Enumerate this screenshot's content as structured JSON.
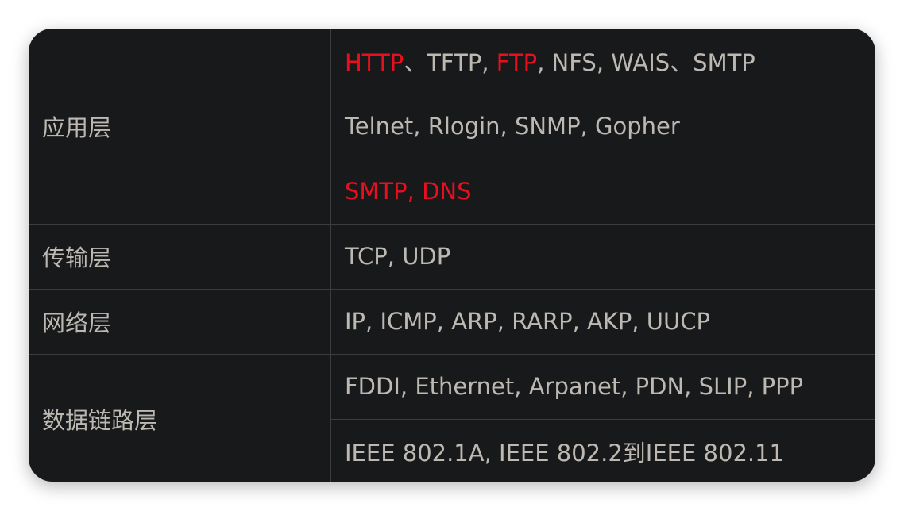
{
  "colors": {
    "card_background": "#18191b",
    "text": "#bdb9b2",
    "highlight": "#ea0f1f",
    "border": "#3a3c3f"
  },
  "table": {
    "layers": [
      {
        "name": "应用层",
        "rows": [
          [
            {
              "text": "HTTP",
              "highlight": true
            },
            {
              "text": "、TFTP, ",
              "highlight": false
            },
            {
              "text": "FTP",
              "highlight": true
            },
            {
              "text": ", NFS, WAIS、SMTP",
              "highlight": false
            }
          ],
          [
            {
              "text": "Telnet, Rlogin, SNMP, Gopher",
              "highlight": false
            }
          ],
          [
            {
              "text": "SMTP, DNS",
              "highlight": true
            }
          ]
        ]
      },
      {
        "name": "传输层",
        "rows": [
          [
            {
              "text": "TCP, UDP",
              "highlight": false
            }
          ]
        ]
      },
      {
        "name": "网络层",
        "rows": [
          [
            {
              "text": "IP, ICMP, ARP, RARP, AKP, UUCP",
              "highlight": false
            }
          ]
        ]
      },
      {
        "name": "数据链路层",
        "rows": [
          [
            {
              "text": "FDDI, Ethernet, Arpanet, PDN, SLIP, PPP",
              "highlight": false
            }
          ],
          [
            {
              "text": "IEEE 802.1A, IEEE 802.2到IEEE 802.11",
              "highlight": false
            }
          ]
        ]
      }
    ]
  }
}
